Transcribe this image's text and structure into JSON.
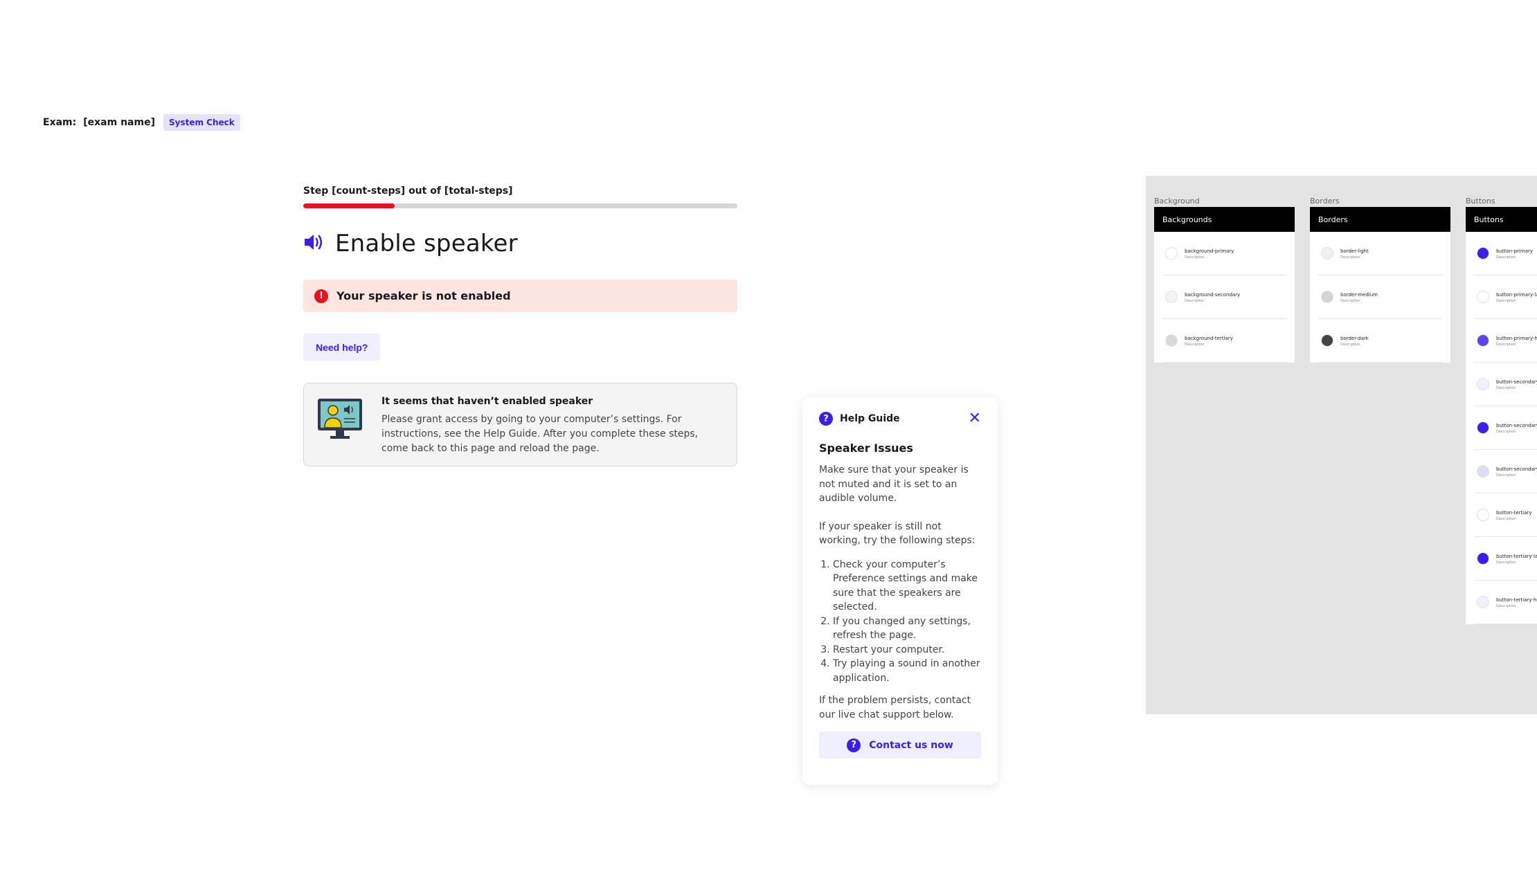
{
  "header": {
    "exam_label": "Exam:",
    "exam_name": "[exam name]",
    "badge": "System Check"
  },
  "step": {
    "text": "Step [count-steps] out of [total-steps]",
    "progress_fraction": 0.21
  },
  "page": {
    "title": "Enable speaker"
  },
  "error": {
    "icon": "!",
    "text": "Your speaker is not enabled"
  },
  "need_help": {
    "label": "Need help?"
  },
  "info_card": {
    "title": "It seems that haven’t enabled speaker",
    "body": "Please grant access by going to your computer’s settings. For instructions, see the Help Guide. After you complete these steps, come back to this page and reload the page."
  },
  "help_guide": {
    "title": "Help Guide",
    "close": "✕",
    "icon": "?",
    "heading": "Speaker Issues",
    "p1": "Make sure that your speaker is not muted and it is set to an audible volume.",
    "p2": "If your speaker is still not working, try the following steps:",
    "steps": [
      "Check your computer’s Preference settings and make sure that the speakers are selected.",
      "If you changed any settings, refresh the page.",
      "Restart your computer.",
      "Try playing a sound in another application."
    ],
    "p3": "If the problem persists, contact our live chat support below.",
    "contact": "Contact us now"
  },
  "design_system": {
    "columns": [
      {
        "caption": "Background",
        "header": "Backgrounds",
        "items": [
          {
            "name": "background-primary",
            "desc": "Description",
            "color": "#ffffff"
          },
          {
            "name": "background-secondary",
            "desc": "Description",
            "color": "#f3f3f3"
          },
          {
            "name": "background-tertiary",
            "desc": "Description",
            "color": "#d9d9d9"
          }
        ]
      },
      {
        "caption": "Borders",
        "header": "Borders",
        "items": [
          {
            "name": "border-light",
            "desc": "Description",
            "color": "#f0f0f0"
          },
          {
            "name": "border-medium",
            "desc": "Description",
            "color": "#d4d4d4"
          },
          {
            "name": "border-dark",
            "desc": "Description",
            "color": "#444444"
          }
        ]
      },
      {
        "caption": "Buttons",
        "header": "Buttons",
        "items": [
          {
            "name": "button-primary",
            "desc": "Description",
            "color": "#3c1ee6"
          },
          {
            "name": "button-primary-label",
            "desc": "Description",
            "color": "#ffffff"
          },
          {
            "name": "button-primary-hover",
            "desc": "Description",
            "color": "#5b45e8"
          },
          {
            "name": "button-secondary",
            "desc": "Description",
            "color": "#f1f1fb"
          },
          {
            "name": "button-secondary-label",
            "desc": "Description",
            "color": "#3c1ee6"
          },
          {
            "name": "button-secondary-hover",
            "desc": "Description",
            "color": "#dcdcf7"
          },
          {
            "name": "button-tertiary",
            "desc": "Description",
            "color": "#ffffff"
          },
          {
            "name": "button-tertiary-label",
            "desc": "Description",
            "color": "#3c1ee6"
          },
          {
            "name": "button-tertiary-hover",
            "desc": "Description",
            "color": "#f1f1fb"
          }
        ]
      }
    ]
  },
  "colors": {
    "accent": "#3c1ee6",
    "error": "#e8111e",
    "error_bg": "#fde6e2"
  }
}
